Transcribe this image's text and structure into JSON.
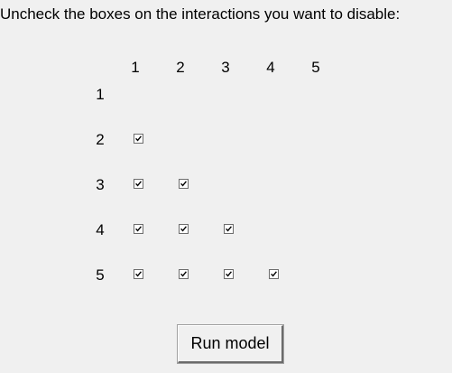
{
  "instruction": "Uncheck the boxes on the interactions you want to disable:",
  "column_headers": [
    "1",
    "2",
    "3",
    "4",
    "5"
  ],
  "row_headers": [
    "1",
    "2",
    "3",
    "4",
    "5"
  ],
  "interactions": [
    {
      "row": "2",
      "col": "1",
      "checked": true
    },
    {
      "row": "3",
      "col": "1",
      "checked": true
    },
    {
      "row": "3",
      "col": "2",
      "checked": true
    },
    {
      "row": "4",
      "col": "1",
      "checked": true
    },
    {
      "row": "4",
      "col": "2",
      "checked": true
    },
    {
      "row": "4",
      "col": "3",
      "checked": true
    },
    {
      "row": "5",
      "col": "1",
      "checked": true
    },
    {
      "row": "5",
      "col": "2",
      "checked": true
    },
    {
      "row": "5",
      "col": "3",
      "checked": true
    },
    {
      "row": "5",
      "col": "4",
      "checked": true
    }
  ],
  "run_button_label": "Run model"
}
